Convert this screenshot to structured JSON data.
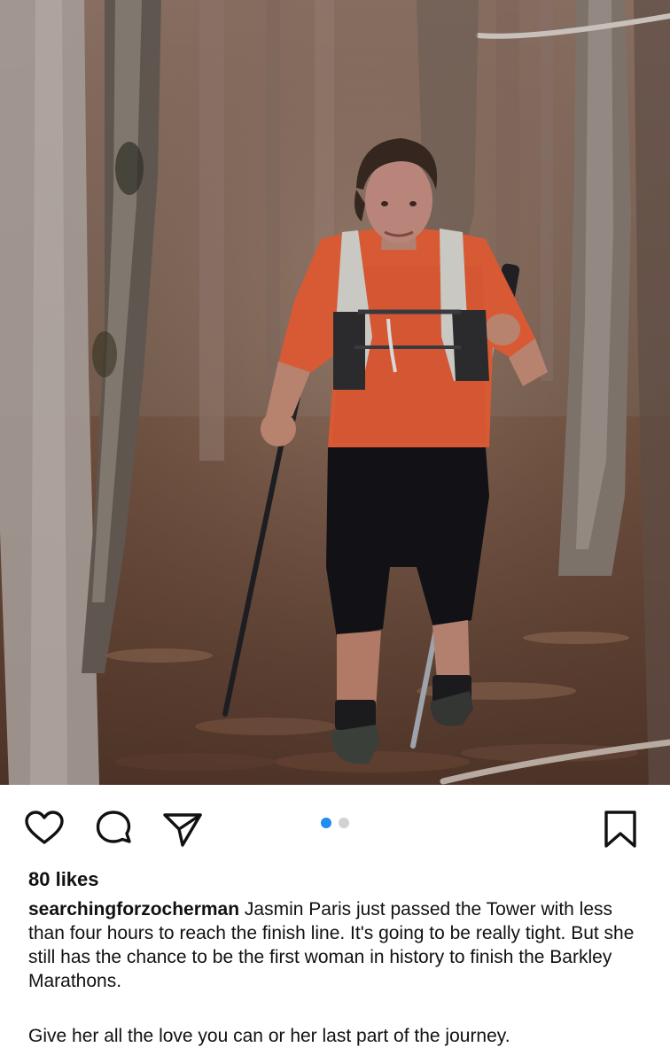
{
  "post": {
    "image": {
      "alt": "Jasmin Paris hiking in forest with trekking poles",
      "carousel": {
        "active_index": 1,
        "total": 2
      }
    },
    "actions": {
      "icons": {
        "like": "heart-icon",
        "comment": "comment-icon",
        "share": "send-icon",
        "save": "bookmark-icon"
      }
    },
    "likes_text": "80 likes",
    "caption": {
      "username": "searchingforzocherman",
      "text": " Jasmin Paris just passed the Tower with less than four hours to reach the finish line. It's going to be really tight. But she still has the chance to be the first woman in history to finish the Barkley Marathons.",
      "second_paragraph": "Give her all the love you can or her last part of the journey."
    }
  },
  "colors": {
    "accent_blue": "#1f8cf0",
    "shirt_orange": "#d85a35",
    "text": "#111111",
    "inactive_dot": "#d2d2d2"
  }
}
